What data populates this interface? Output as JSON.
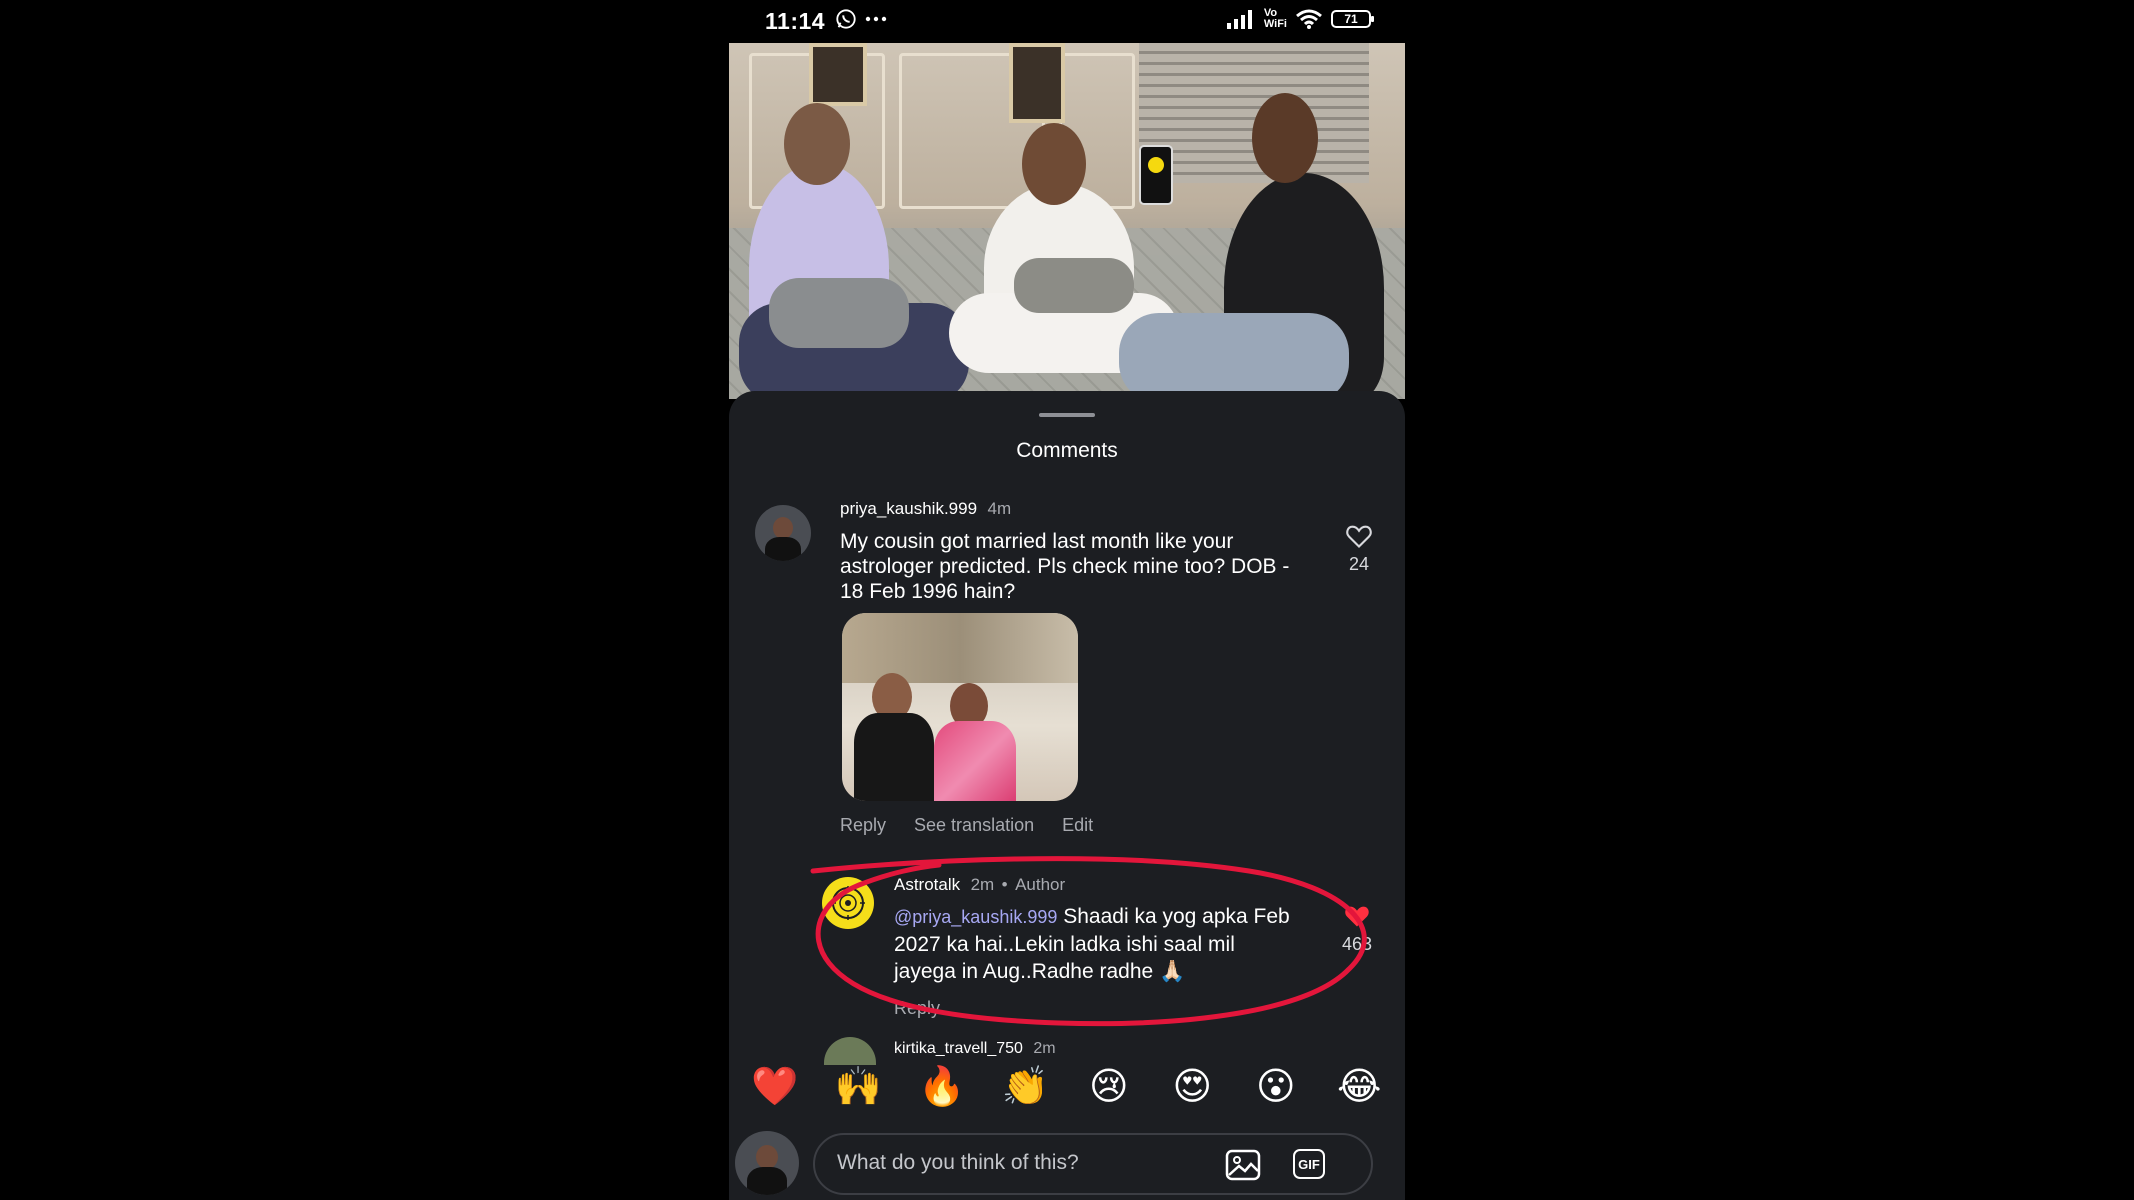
{
  "status_bar": {
    "time": "11:14",
    "network_label": "Vo\nWiFi",
    "battery": "71",
    "icons": [
      "whatsapp-icon",
      "more-dots-icon",
      "signal-bars-icon",
      "wifi-icon",
      "battery-icon"
    ]
  },
  "sheet": {
    "title": "Comments"
  },
  "comments": [
    {
      "username": "priya_kaushik.999",
      "time": "4m",
      "text": "My cousin got married last month like your astrologer predicted.  Pls check mine too? DOB - 18 Feb 1996 hain?",
      "likes": "24",
      "actions": [
        "Reply",
        "See translation",
        "Edit"
      ]
    }
  ],
  "reply": {
    "username": "Astrotalk",
    "time": "2m",
    "badge": "Author",
    "separator": "•",
    "mention": "@priya_kaushik.999",
    "text": "Shaadi ka yog apka Feb 2027 ka hai..Lekin ladka ishi saal mil jayega in Aug..Radhe radhe 🙏🏻",
    "likes": "463",
    "action": "Reply",
    "highlight_color": "#e3163b"
  },
  "next_comment": {
    "username": "kirtika_travell_750",
    "time": "2m"
  },
  "emoji_reactions": [
    "❤️",
    "🙌",
    "🔥",
    "👏",
    "😢",
    "😍",
    "😮",
    "😂"
  ],
  "composer": {
    "placeholder": "What do you think of this?",
    "gif_label": "GIF"
  },
  "colors": {
    "sheet_bg": "#1c1e22",
    "like_red": "#ff3040",
    "mention": "#a7a8f3"
  }
}
